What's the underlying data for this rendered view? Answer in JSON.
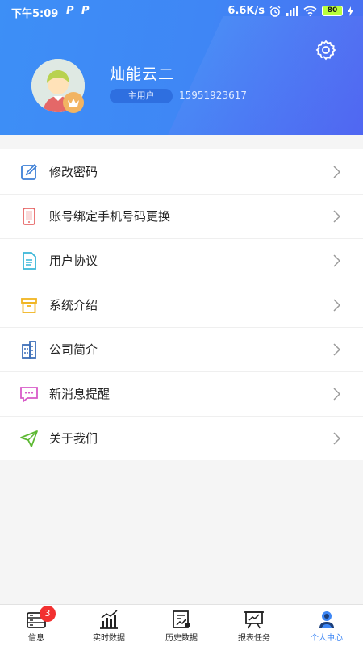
{
  "status_bar": {
    "time": "下午5:09",
    "p1": "P",
    "p2": "P",
    "net_speed": "6.6K/s",
    "battery": "80"
  },
  "profile": {
    "name": "灿能云二",
    "role": "主用户",
    "phone": "15951923617"
  },
  "menu": {
    "items": [
      {
        "label": "修改密码",
        "icon": "edit-icon",
        "color": "#3c7fd6"
      },
      {
        "label": "账号绑定手机号码更换",
        "icon": "tablet-icon",
        "color": "#e86a6a"
      },
      {
        "label": "用户协议",
        "icon": "document-icon",
        "color": "#39b6d8"
      },
      {
        "label": "系统介绍",
        "icon": "box-icon",
        "color": "#f0b420"
      },
      {
        "label": "公司简介",
        "icon": "building-icon",
        "color": "#3d6fb8"
      },
      {
        "label": "新消息提醒",
        "icon": "message-icon",
        "color": "#d85ac8"
      },
      {
        "label": "关于我们",
        "icon": "send-icon",
        "color": "#5cb832"
      }
    ]
  },
  "bottom_nav": {
    "items": [
      {
        "label": "信息",
        "badge": "3"
      },
      {
        "label": "实时数据"
      },
      {
        "label": "历史数据"
      },
      {
        "label": "报表任务"
      },
      {
        "label": "个人中心"
      }
    ],
    "active_index": 4,
    "active_color": "#3e87f5"
  }
}
